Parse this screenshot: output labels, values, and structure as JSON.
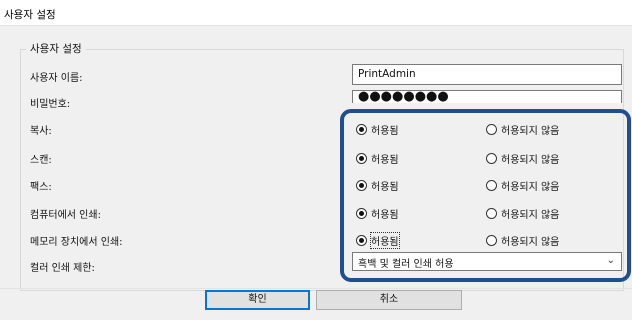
{
  "window": {
    "title": "사용자 설정"
  },
  "group": {
    "legend": "사용자 설정"
  },
  "fields": {
    "username_label": "사용자 이름:",
    "username_value": "PrintAdmin",
    "password_label": "비밀번호:",
    "password_value": "●●●●●●●●"
  },
  "permissions": [
    {
      "label": "복사:",
      "allowed": "허용됨",
      "denied": "허용되지 않음",
      "selected": "allowed"
    },
    {
      "label": "스캔:",
      "allowed": "허용됨",
      "denied": "허용되지 않음",
      "selected": "allowed"
    },
    {
      "label": "팩스:",
      "allowed": "허용됨",
      "denied": "허용되지 않음",
      "selected": "allowed"
    },
    {
      "label": "컴퓨터에서 인쇄:",
      "allowed": "허용됨",
      "denied": "허용되지 않음",
      "selected": "allowed"
    },
    {
      "label": "메모리 장치에서 인쇄:",
      "allowed": "허용됨",
      "denied": "허용되지 않음",
      "selected": "allowed"
    }
  ],
  "color_limit": {
    "label": "컬러 인쇄 제한:",
    "value": "흑백 및 컬러 인쇄 허용"
  },
  "buttons": {
    "ok": "확인",
    "cancel": "취소"
  },
  "colors": {
    "highlight": "#1e4f91",
    "dialog_bg": "#f0f0f0",
    "default_button_border": "#0078d7"
  }
}
